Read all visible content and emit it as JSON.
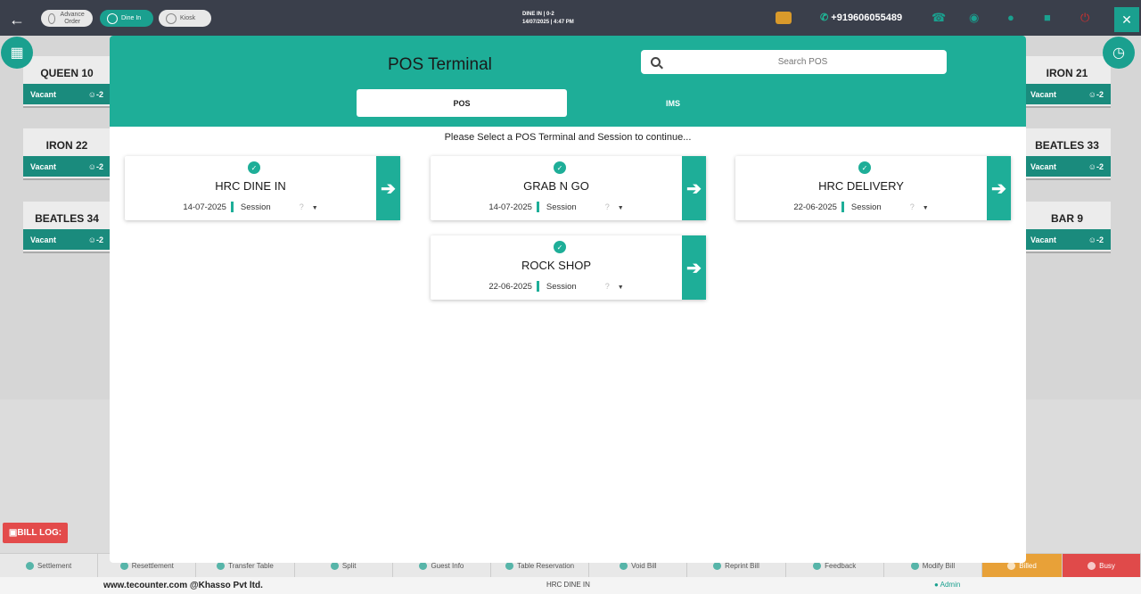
{
  "topbar": {
    "back_icon": "arrow-left-icon",
    "advance_order": "Advance Order",
    "dine_in": "Dine In",
    "kiosk": "Kiosk",
    "center_line1": "DINE IN | 0-2",
    "center_line2": "14/07/2025 | 4:47 PM",
    "phone": "+919606055489"
  },
  "tables": {
    "left": [
      {
        "name": "QUEEN 10",
        "status": "Vacant",
        "guests": "-2"
      },
      {
        "name": "IRON 22",
        "status": "Vacant",
        "guests": "-2"
      },
      {
        "name": "BEATLES 34",
        "status": "Vacant",
        "guests": "-2"
      }
    ],
    "right": [
      {
        "name": "IRON 21",
        "status": "Vacant",
        "guests": "-2"
      },
      {
        "name": "BEATLES 33",
        "status": "Vacant",
        "guests": "-2"
      },
      {
        "name": "BAR 9",
        "status": "Vacant",
        "guests": "-2"
      }
    ]
  },
  "modal": {
    "title": "POS Terminal",
    "search_placeholder": "Search POS",
    "tabs": [
      "POS",
      "IMS"
    ],
    "prompt": "Please Select a POS Terminal and Session to continue...",
    "terminals": [
      {
        "name": "HRC DINE IN",
        "date": "14-07-2025",
        "session": "Session",
        "q": "?"
      },
      {
        "name": "GRAB N GO",
        "date": "14-07-2025",
        "session": "Session",
        "q": "?"
      },
      {
        "name": "HRC DELIVERY",
        "date": "22-06-2025",
        "session": "Session",
        "q": "?"
      },
      {
        "name": "ROCK SHOP",
        "date": "22-06-2025",
        "session": "Session",
        "q": "?"
      }
    ]
  },
  "bill_log": "BILL LOG:",
  "bottom_actions": [
    "Settlement",
    "Resettlement",
    "Transfer Table",
    "Split",
    "Guest Info",
    "Table Reservation",
    "Void Bill",
    "Reprint Bill",
    "Feedback",
    "Modify Bill",
    "Billed",
    "Busy"
  ],
  "footer": {
    "left": "www.tecounter.com @Khasso Pvt ltd.",
    "center": "HRC DINE IN",
    "right": "Admin"
  },
  "colors": {
    "accent": "#1eae98",
    "topbar": "#3a3f4b",
    "billed": "#e8a138",
    "busy": "#e04a4a"
  }
}
